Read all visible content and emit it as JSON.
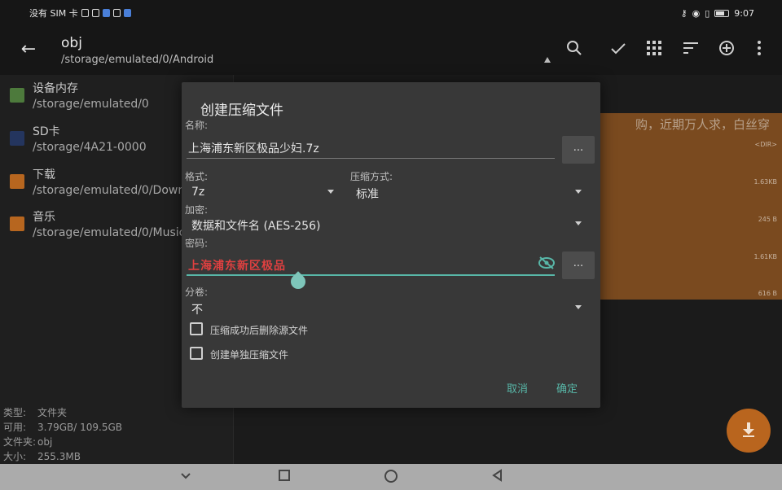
{
  "status_bar": {
    "carrier_text": "没有 SIM 卡",
    "time": "9:07"
  },
  "app_bar": {
    "title": "obj",
    "path": "/storage/emulated/0/Android",
    "icons": [
      "back-arrow-icon",
      "search-icon",
      "check-icon",
      "grid-icon",
      "sort-icon",
      "add-circle-icon",
      "more-vert-icon"
    ]
  },
  "sidebar": {
    "items": [
      {
        "name": "设备内存",
        "path": "/storage/emulated/0",
        "icon": "device-storage-icon"
      },
      {
        "name": "SD卡",
        "path": "/storage/4A21-0000",
        "icon": "sd-card-icon"
      },
      {
        "name": "下载",
        "path": "/storage/emulated/0/Down",
        "icon": "folder-icon"
      },
      {
        "name": "音乐",
        "path": "/storage/emulated/0/Music",
        "icon": "folder-icon"
      }
    ],
    "info": [
      {
        "label": "类型:",
        "value": "文件夹"
      },
      {
        "label": "可用:",
        "value": "3.79GB/ 109.5GB"
      },
      {
        "label": "文件夹:",
        "value": "obj"
      },
      {
        "label": "大小:",
        "value": "255.3MB"
      }
    ]
  },
  "background_card": {
    "text": "购，近期万人求，白丝穿",
    "sizes": [
      "<DIR>",
      "1.63KB",
      "245 B",
      "1.61KB",
      "616 B"
    ]
  },
  "dialog": {
    "title": "创建压缩文件",
    "name_label": "名称:",
    "name_value": "上海浦东新区极品少妇.7z",
    "browse_label": "...",
    "format_label": "格式:",
    "format_value": "7z",
    "compress_label": "压缩方式:",
    "compress_value": "标准",
    "encrypt_label": "加密:",
    "encrypt_value": "数据和文件名 (AES-256)",
    "password_label": "密码:",
    "password_value": "上海浦东新区极品",
    "password_browse_label": "...",
    "volume_label": "分卷:",
    "volume_value": "不",
    "option1_label": "压缩成功后删除源文件",
    "option2_label": "创建单独压缩文件",
    "cancel_label": "取消",
    "ok_label": "确定"
  },
  "colors": {
    "accent": "#58b7a8",
    "fab": "#b9651e",
    "password_text": "#e04040"
  }
}
